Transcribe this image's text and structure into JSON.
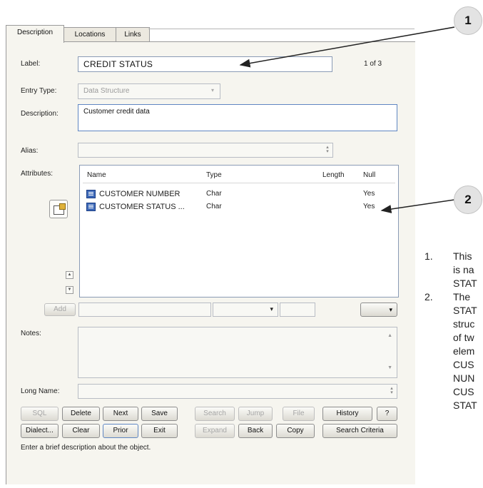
{
  "tabs": [
    {
      "label": "Description",
      "active": true
    },
    {
      "label": "Locations",
      "active": false
    },
    {
      "label": "Links",
      "active": false
    }
  ],
  "form": {
    "label_caption": "Label:",
    "label_value": "CREDIT STATUS",
    "record_counter": "1 of 3",
    "entry_type_caption": "Entry Type:",
    "entry_type_value": "Data Structure",
    "description_caption": "Description:",
    "description_value": "Customer credit data",
    "alias_caption": "Alias:",
    "alias_value": "",
    "attributes_caption": "Attributes:",
    "add_label": "Add",
    "notes_caption": "Notes:",
    "notes_value": "",
    "long_name_caption": "Long Name:",
    "long_name_value": ""
  },
  "attributes": {
    "columns": [
      "Name",
      "Type",
      "Length",
      "Null"
    ],
    "rows": [
      {
        "name": "CUSTOMER NUMBER",
        "type": "Char",
        "length": "",
        "null": "Yes"
      },
      {
        "name": "CUSTOMER STATUS ...",
        "type": "Char",
        "length": "",
        "null": "Yes"
      }
    ]
  },
  "buttons_row1": [
    {
      "label": "SQL",
      "enabled": false
    },
    {
      "label": "Delete",
      "enabled": true
    },
    {
      "label": "Next",
      "enabled": true
    },
    {
      "label": "Save",
      "enabled": true
    },
    {
      "label": "Search",
      "enabled": false
    },
    {
      "label": "Jump",
      "enabled": false
    },
    {
      "label": "File",
      "enabled": false
    },
    {
      "label": "History",
      "enabled": true
    },
    {
      "label": "?",
      "enabled": true
    }
  ],
  "buttons_row2": [
    {
      "label": "Dialect...",
      "enabled": true
    },
    {
      "label": "Clear",
      "enabled": true
    },
    {
      "label": "Prior",
      "enabled": true
    },
    {
      "label": "Exit",
      "enabled": true
    },
    {
      "label": "Expand",
      "enabled": false
    },
    {
      "label": "Back",
      "enabled": true
    },
    {
      "label": "Copy",
      "enabled": true
    },
    {
      "label": "Search Criteria",
      "enabled": true
    }
  ],
  "status_text": "Enter a brief description about the object.",
  "callouts": [
    "1",
    "2"
  ],
  "notes_list": [
    {
      "number": "1.",
      "lines": [
        "This",
        "is na",
        "STAT"
      ]
    },
    {
      "number": "2.",
      "lines": [
        "The",
        "STAT",
        "struc",
        "of tw",
        "elem",
        "CUS",
        "NUN",
        "CUS",
        "STAT"
      ]
    }
  ],
  "colors": {
    "panel": "#f6f5ef",
    "field_border": "#8a9bb5",
    "row_icon": "#3d69b8"
  }
}
